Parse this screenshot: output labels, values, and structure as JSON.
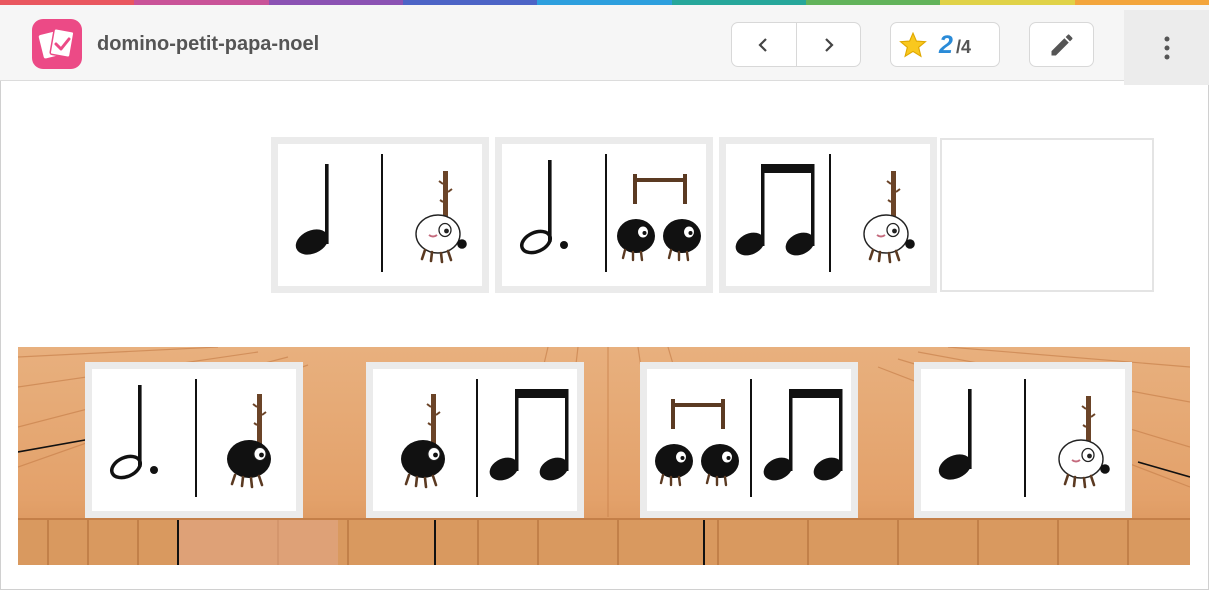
{
  "header": {
    "title": "domino-petit-papa-noel",
    "score": {
      "current": "2",
      "total": "/4"
    },
    "prev_icon": "chevron-left-icon",
    "next_icon": "chevron-right-icon",
    "star_icon": "star-icon",
    "edit_icon": "pencil-icon",
    "menu_icon": "more-vertical-icon",
    "logo_icon": "cards-logo-icon"
  },
  "colors": {
    "brand": "#ec4a86",
    "score": "#2a8bd8",
    "star": "#f9c81e",
    "wood": "#e3a16a",
    "rainbow": [
      "#e9575f",
      "#c95398",
      "#8b52b3",
      "#4d64c6",
      "#2d9fde",
      "#27a79b",
      "#62b35b",
      "#e0d248",
      "#f3a53c"
    ]
  },
  "board": {
    "placed": [
      {
        "left": "quarter-note",
        "right": "white-ball-creature"
      },
      {
        "left": "dotted-half-note",
        "right": "two-black-ball-creatures"
      },
      {
        "left": "two-beamed-eighth-notes",
        "right": "white-ball-creature"
      }
    ],
    "empty_slot": "drop-slot"
  },
  "hand": [
    {
      "left": "dotted-half-note",
      "right": "black-ball-creature"
    },
    {
      "left": "black-ball-creature",
      "right": "two-beamed-eighth-notes"
    },
    {
      "left": "two-black-ball-creatures",
      "right": "two-beamed-eighth-notes"
    },
    {
      "left": "quarter-note",
      "right": "white-ball-creature"
    }
  ]
}
